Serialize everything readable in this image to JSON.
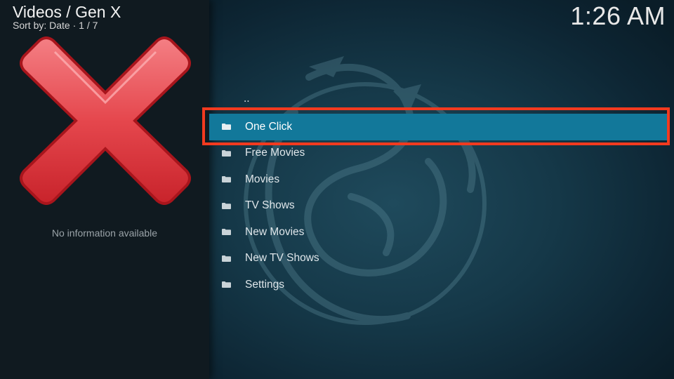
{
  "header": {
    "title": "Videos / Gen X",
    "subtitle": "Sort by: Date  ·  1 / 7"
  },
  "clock": "1:26 AM",
  "info_panel": {
    "thumbnail_icon": "red-x-icon",
    "message": "No information available"
  },
  "list": {
    "parent_label": "..",
    "items": [
      {
        "label": "One Click",
        "icon": "folder-icon",
        "selected": true
      },
      {
        "label": "Free Movies",
        "icon": "folder-icon",
        "selected": false
      },
      {
        "label": "Movies",
        "icon": "folder-icon",
        "selected": false
      },
      {
        "label": "TV Shows",
        "icon": "folder-icon",
        "selected": false
      },
      {
        "label": "New Movies",
        "icon": "folder-icon",
        "selected": false
      },
      {
        "label": "New TV Shows",
        "icon": "folder-icon",
        "selected": false
      },
      {
        "label": "Settings",
        "icon": "folder-icon",
        "selected": false
      }
    ]
  },
  "colors": {
    "selection": "#12789a",
    "annotation_box": "#f23a1f",
    "x_red": "#e53a40"
  }
}
